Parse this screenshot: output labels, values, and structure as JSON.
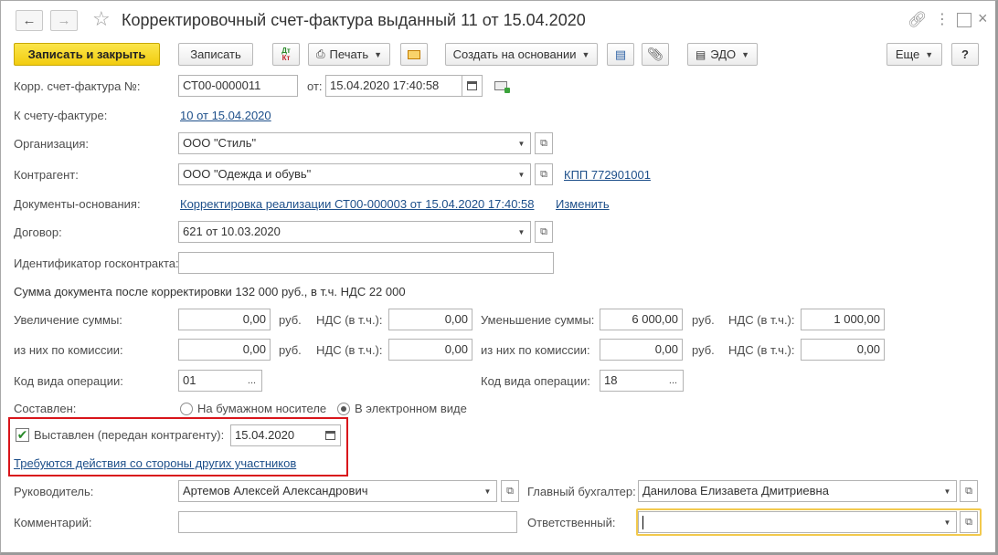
{
  "header": {
    "title": "Корректировочный счет-фактура выданный 11 от 15.04.2020",
    "back_icon": "arrow-left-icon",
    "forward_icon": "arrow-right-icon"
  },
  "toolbar": {
    "save_close": "Записать и закрыть",
    "save": "Записать",
    "dtkt_top": "Дт",
    "dtkt_bottom": "Кт",
    "print": "Печать",
    "create_based": "Создать на основании",
    "edo": "ЭДО",
    "more": "Еще",
    "help": "?"
  },
  "form": {
    "corr_invoice_label": "Корр. счет-фактура №:",
    "corr_invoice_number": "СТ00-0000011",
    "from_label": "от:",
    "from_date": "15.04.2020 17:40:58",
    "to_invoice_label": "К счету-фактуре:",
    "to_invoice_link": "10 от 15.04.2020",
    "org_label": "Организация:",
    "org_value": "ООО \"Стиль\"",
    "counterparty_label": "Контрагент:",
    "counterparty_value": "ООО \"Одежда и обувь\"",
    "kpp_link": "КПП 772901001",
    "base_docs_label": "Документы-основания:",
    "base_docs_link": "Корректировка реализации СТ00-000003 от 15.04.2020 17:40:58",
    "change_link": "Изменить",
    "contract_label": "Договор:",
    "contract_value": "621 от 10.03.2020",
    "gov_contract_label": "Идентификатор госконтракта:",
    "gov_contract_value": "",
    "sum_text": "Сумма документа после корректировки 132 000 руб., в т.ч. НДС 22 000",
    "increase_label": "Увеличение суммы:",
    "increase_value": "0,00",
    "rub": "руб.",
    "vat_label": "НДС (в т.ч.):",
    "increase_vat": "0,00",
    "decrease_label": "Уменьшение суммы:",
    "decrease_value": "6 000,00",
    "decrease_vat": "1 000,00",
    "commission_label": "из них по комиссии:",
    "inc_comm_value": "0,00",
    "inc_comm_vat": "0,00",
    "dec_comm_value": "0,00",
    "dec_comm_vat": "0,00",
    "op_code_label": "Код вида операции:",
    "op_code_left": "01",
    "op_code_right": "18",
    "dots": "...",
    "composed_label": "Составлен:",
    "radio_paper": "На бумажном носителе",
    "radio_electronic": "В электронном виде",
    "issued_label": "Выставлен (передан контрагенту):",
    "issued_date": "15.04.2020",
    "actions_link": "Требуются действия со стороны других участников",
    "head_label": "Руководитель:",
    "head_value": "Артемов Алексей Александрович",
    "chief_acc_label": "Главный бухгалтер:",
    "chief_acc_value": "Данилова Елизавета Дмитриевна",
    "comment_label": "Комментарий:",
    "comment_value": "",
    "responsible_label": "Ответственный:",
    "responsible_value": ""
  }
}
